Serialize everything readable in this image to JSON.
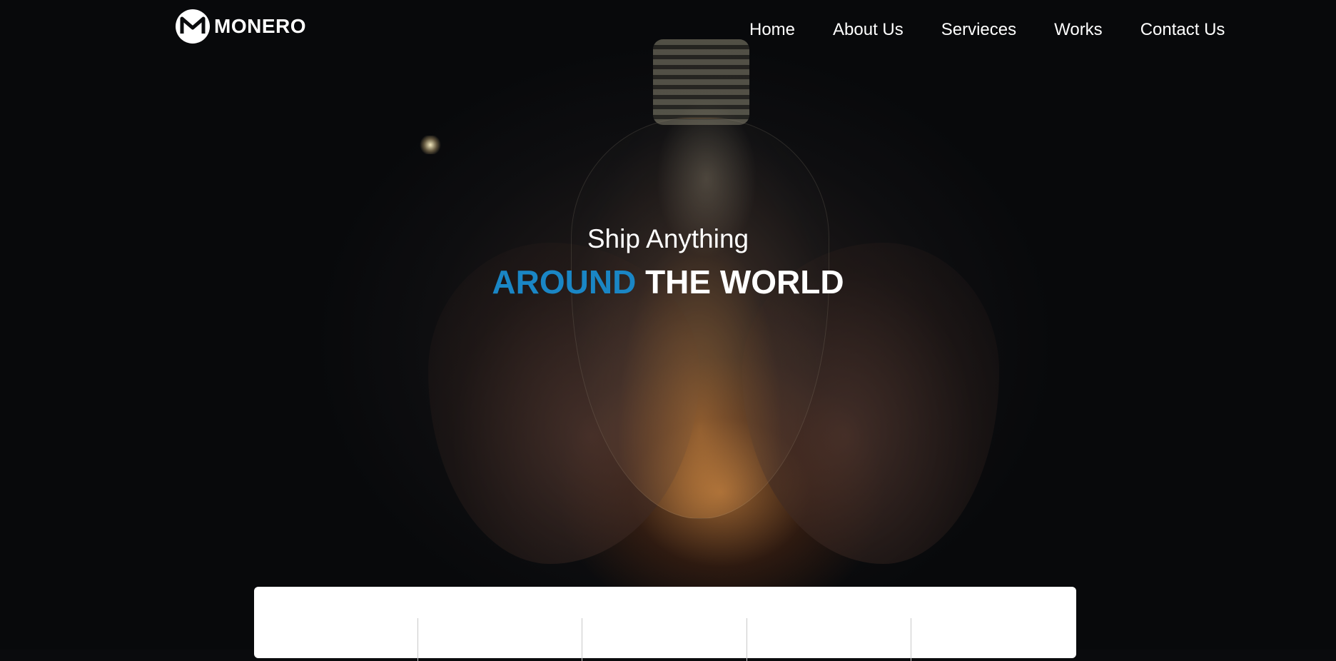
{
  "brand": {
    "name": "MONERO",
    "icon": "monero-m-icon"
  },
  "nav": {
    "items": [
      {
        "label": "Home"
      },
      {
        "label": "About Us"
      },
      {
        "label": "Servieces"
      },
      {
        "label": "Works"
      },
      {
        "label": "Contact Us"
      }
    ]
  },
  "hero": {
    "subtitle": "Ship Anything",
    "title_accent": "AROUND",
    "title_rest": "THE WORLD",
    "accent_color": "#1a86c5"
  },
  "colors": {
    "background": "#0a0b0d",
    "text": "#ffffff",
    "card": "#ffffff"
  }
}
